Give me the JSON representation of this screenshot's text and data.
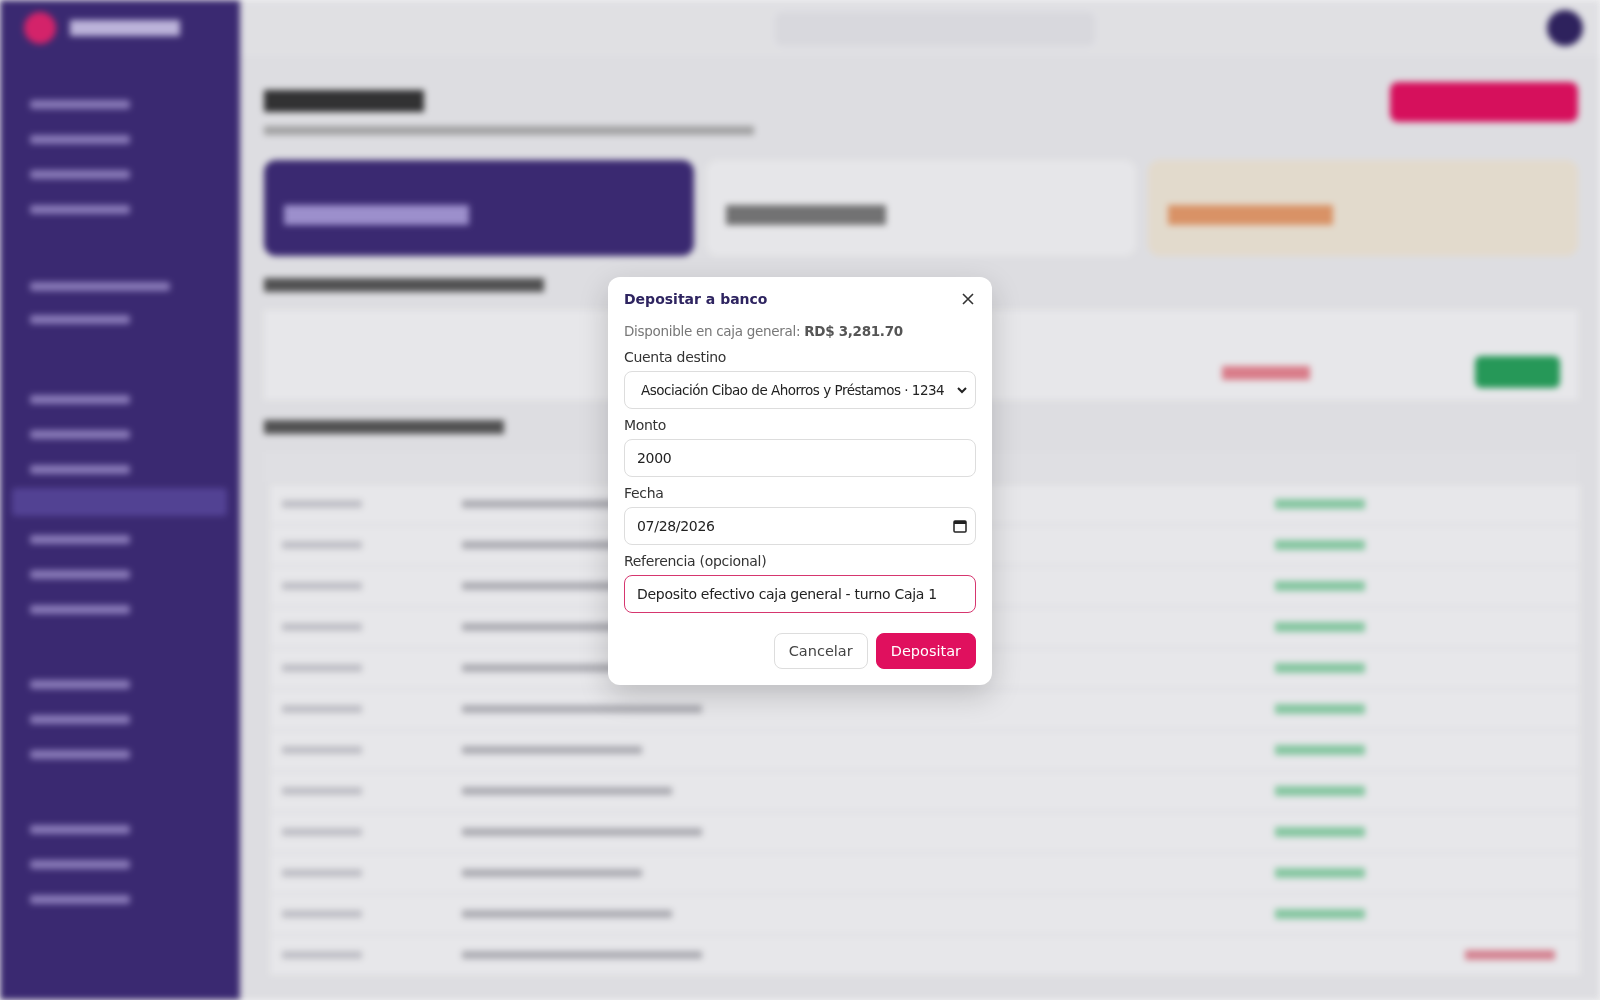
{
  "dialog": {
    "title": "Depositar a banco",
    "available_label": "Disponible en caja general:",
    "available_amount": "RD$ 3,281.70",
    "fields": [
      {
        "kind": "select",
        "label": "Cuenta destino",
        "value": "Asociación Cibao de Ahorros y Préstamos · 1234",
        "focused": false
      },
      {
        "kind": "text",
        "label": "Monto",
        "value": "2000",
        "focused": false
      },
      {
        "kind": "date",
        "label": "Fecha",
        "value": "07/28/2026",
        "focused": false
      },
      {
        "kind": "text",
        "label": "Referencia (opcional)",
        "value": "Deposito efectivo caja general - turno Caja 1",
        "focused": true
      }
    ],
    "buttons": [
      {
        "label": "Cancelar",
        "kind": "secondary"
      },
      {
        "label": "Depositar",
        "kind": "primary"
      }
    ]
  }
}
